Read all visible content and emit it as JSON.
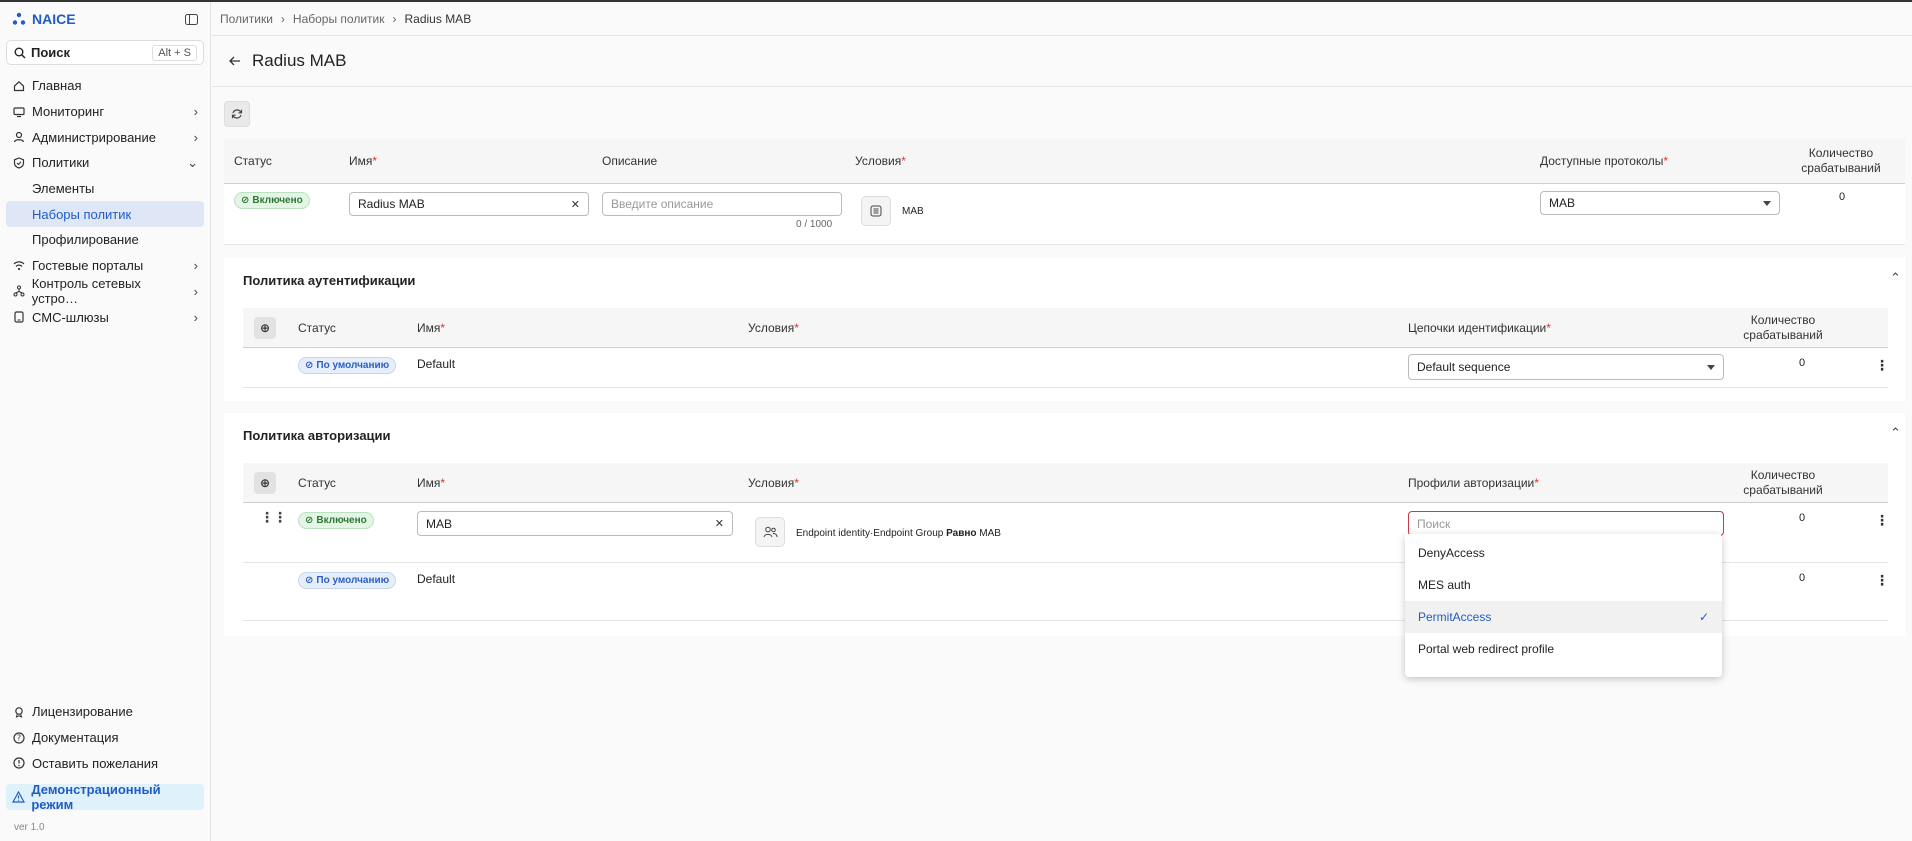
{
  "app": {
    "name": "NAICE",
    "version": "ver 1.0"
  },
  "search": {
    "label": "Поиск",
    "shortcut": "Alt + S"
  },
  "sidebar": {
    "items": [
      {
        "label": "Главная",
        "icon": "home-icon"
      },
      {
        "label": "Мониторинг",
        "icon": "monitor-icon"
      },
      {
        "label": "Администрирование",
        "icon": "user-icon"
      },
      {
        "label": "Политики",
        "icon": "shield-icon"
      },
      {
        "label": "Элементы"
      },
      {
        "label": "Наборы политик"
      },
      {
        "label": "Профилирование"
      },
      {
        "label": "Гостевые порталы",
        "icon": "wifi-icon"
      },
      {
        "label": "Контроль сетевых устро…",
        "icon": "network-icon"
      },
      {
        "label": "СМС-шлюзы",
        "icon": "sms-icon"
      }
    ],
    "bottom": [
      {
        "label": "Лицензирование"
      },
      {
        "label": "Документация"
      },
      {
        "label": "Оставить пожелания"
      }
    ],
    "demo": "Демонстрационный режим"
  },
  "breadcrumb": [
    "Политики",
    "Наборы политик",
    "Radius MAB"
  ],
  "page": {
    "title": "Radius MAB"
  },
  "policy_set": {
    "headers": {
      "status": "Статус",
      "name": "Имя",
      "description": "Описание",
      "conditions": "Условия",
      "protocols": "Доступные протоколы",
      "count": "Количество срабатываний"
    },
    "status": "Включено",
    "name": "Radius MAB",
    "description_placeholder": "Введите описание",
    "char_count": "0 / 1000",
    "condition": "MAB",
    "protocol": "MAB",
    "hits": "0"
  },
  "auth_policy": {
    "title": "Политика аутентификации",
    "headers": {
      "status": "Статус",
      "name": "Имя",
      "conditions": "Условия",
      "chains": "Цепочки идентификации",
      "count": "Количество срабатываний"
    },
    "row": {
      "status": "По умолчанию",
      "name": "Default",
      "chain": "Default sequence",
      "hits": "0"
    }
  },
  "authz_policy": {
    "title": "Политика авторизации",
    "headers": {
      "status": "Статус",
      "name": "Имя",
      "conditions": "Условия",
      "profiles": "Профили авторизации",
      "count": "Количество срабатываний"
    },
    "rows": [
      {
        "status": "Включено",
        "name": "MAB",
        "cond_prefix": "Endpoint identity·Endpoint Group",
        "cond_op": "Равно",
        "cond_value": "MAB",
        "profile_placeholder": "Поиск",
        "hits": "0"
      },
      {
        "status": "По умолчанию",
        "name": "Default",
        "hits": "0"
      }
    ]
  },
  "profile_dropdown": {
    "options": [
      "DenyAccess",
      "MES auth",
      "PermitAccess",
      "Portal web redirect profile"
    ],
    "selected": "PermitAccess"
  },
  "colors": {
    "accent": "#1f5cc5",
    "error": "#d33333",
    "enabled": "#2c7a34"
  }
}
